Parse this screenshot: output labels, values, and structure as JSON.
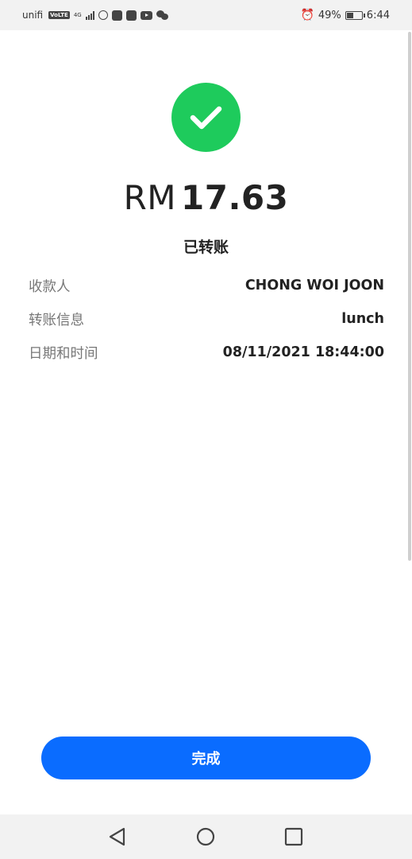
{
  "status_bar": {
    "carrier": "unifi",
    "volte": "VoLTE",
    "network": "4G",
    "battery": "49%",
    "battery_level": 0.49,
    "time": "6:44",
    "icons": [
      "whatsapp-icon",
      "notification-icon",
      "inbox-icon",
      "youtube-icon",
      "wechat-icon",
      "alarm-icon",
      "battery-icon"
    ]
  },
  "receipt": {
    "currency": "RM",
    "amount": "17.63",
    "status": "已转账",
    "details": [
      {
        "label": "收款人",
        "value": "CHONG WOI JOON"
      },
      {
        "label": "转账信息",
        "value": "lunch"
      },
      {
        "label": "日期和时间",
        "value": "08/11/2021 18:44:00"
      }
    ],
    "done_label": "完成"
  },
  "colors": {
    "success": "#1ecb5c",
    "primary_button": "#0a6cff"
  }
}
